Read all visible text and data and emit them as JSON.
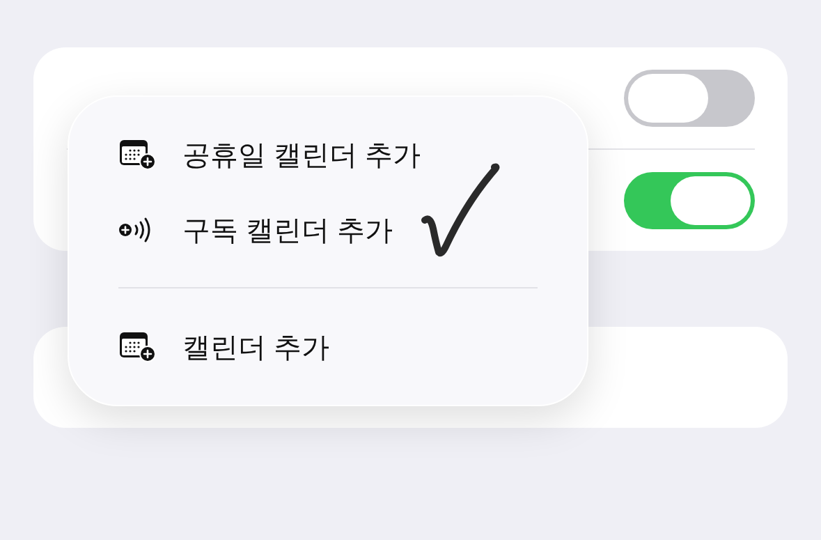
{
  "settings_card": {
    "rows": [
      {
        "on": false
      },
      {
        "on": true
      }
    ]
  },
  "menu": {
    "sections": [
      {
        "items": [
          {
            "kind": "calendar-add",
            "label": "공휴일 캘린더 추가"
          },
          {
            "kind": "subscribe",
            "label": "구독 캘린더 추가"
          }
        ]
      },
      {
        "items": [
          {
            "kind": "calendar-add",
            "label": "캘린더 추가"
          }
        ]
      }
    ]
  }
}
